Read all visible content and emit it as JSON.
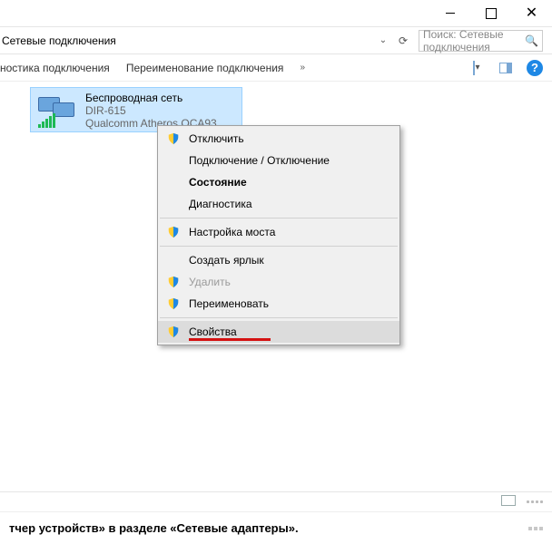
{
  "titlebar": {
    "close_glyph": "✕"
  },
  "address": {
    "path": "Сетевые подключения",
    "dropdown_glyph": "⌄",
    "refresh_glyph": "⟳"
  },
  "search": {
    "placeholder": "Поиск: Сетевые подключения",
    "icon_glyph": "🔍"
  },
  "toolbar": {
    "item1": "ностика подключения",
    "item2": "Переименование подключения",
    "overflow_glyph": "»",
    "help_glyph": "?"
  },
  "connection": {
    "name": "Беспроводная сеть",
    "ssid": "DIR-615",
    "adapter": "Qualcomm Atheros QCA93…"
  },
  "context_menu": {
    "disconnect": "Отключить",
    "connect_disconnect": "Подключение / Отключение",
    "status": "Состояние",
    "diagnostics": "Диагностика",
    "bridge": "Настройка моста",
    "shortcut": "Создать ярлык",
    "delete": "Удалить",
    "rename": "Переименовать",
    "properties": "Свойства"
  },
  "footer": {
    "text": "тчер устройств» в разделе «Сетевые адаптеры»."
  }
}
